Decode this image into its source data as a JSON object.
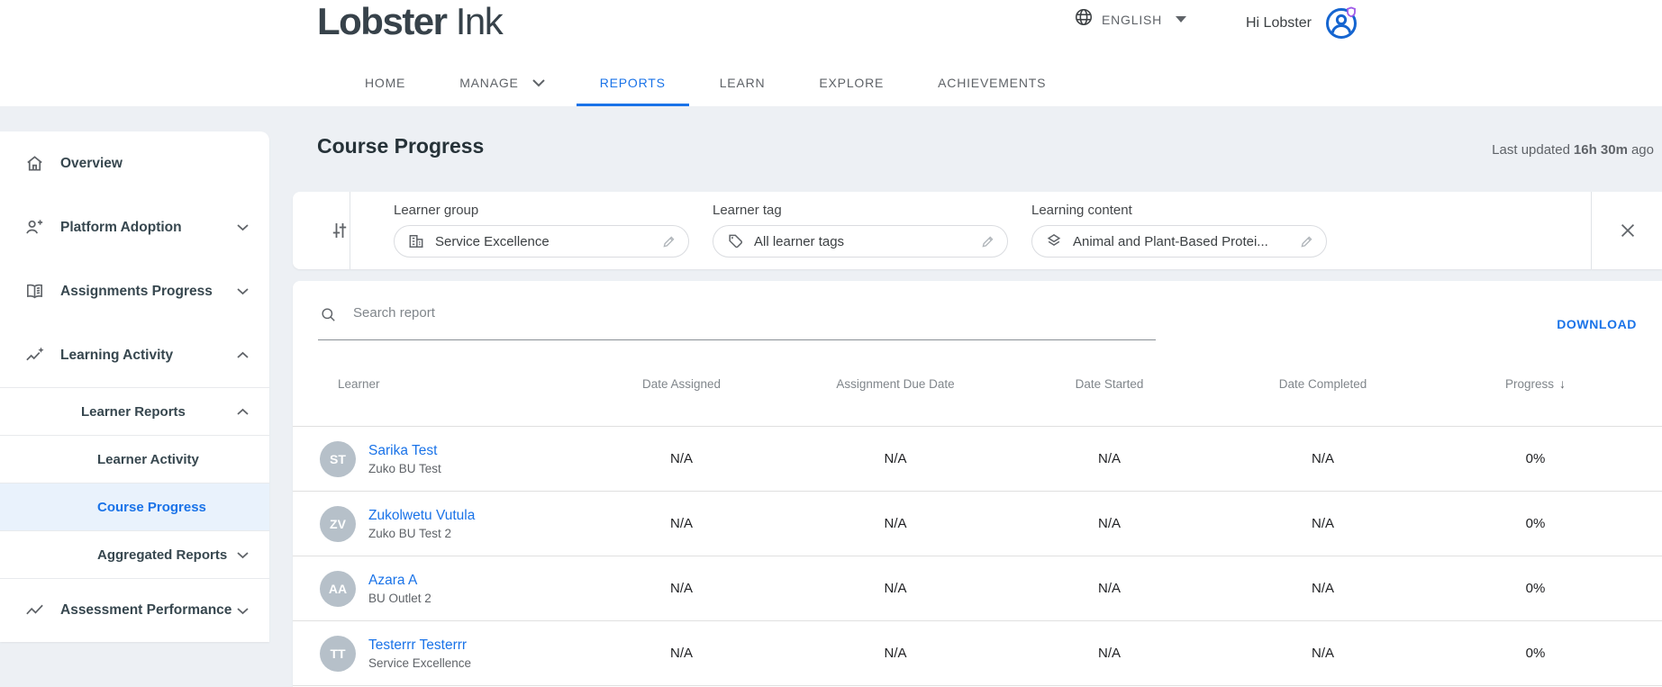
{
  "header": {
    "logo_part1": "Lobster",
    "logo_part2": "Ink",
    "language": "ENGLISH",
    "greeting": "Hi Lobster",
    "nav": {
      "home": "HOME",
      "manage": "MANAGE",
      "reports": "REPORTS",
      "learn": "LEARN",
      "explore": "EXPLORE",
      "achievements": "ACHIEVEMENTS"
    }
  },
  "sidebar": {
    "overview": "Overview",
    "platform_adoption": "Platform Adoption",
    "assignments_progress": "Assignments Progress",
    "learning_activity": "Learning Activity",
    "learner_reports": "Learner Reports",
    "learner_activity": "Learner Activity",
    "course_progress": "Course Progress",
    "aggregated_reports": "Aggregated Reports",
    "assessment_performance": "Assessment Performance"
  },
  "page": {
    "title": "Course Progress",
    "last_updated_label": "Last updated",
    "last_updated_value": "16h 30m",
    "last_updated_suffix": "ago"
  },
  "filters": {
    "learner_group": {
      "label": "Learner group",
      "value": "Service Excellence"
    },
    "learner_tag": {
      "label": "Learner tag",
      "value": "All learner tags"
    },
    "learning_content": {
      "label": "Learning content",
      "value": "Animal and Plant-Based Protei..."
    }
  },
  "report": {
    "search_placeholder": "Search report",
    "download_label": "DOWNLOAD",
    "columns": [
      "Learner",
      "Date Assigned",
      "Assignment Due Date",
      "Date Started",
      "Date Completed",
      "Progress"
    ],
    "sort_icon": "↓",
    "rows": [
      {
        "initials": "ST",
        "name": "Sarika Test",
        "group": "Zuko BU Test",
        "date_assigned": "N/A",
        "due_date": "N/A",
        "date_started": "N/A",
        "date_completed": "N/A",
        "progress": "0%"
      },
      {
        "initials": "ZV",
        "name": "Zukolwetu Vutula",
        "group": "Zuko BU Test 2",
        "date_assigned": "N/A",
        "due_date": "N/A",
        "date_started": "N/A",
        "date_completed": "N/A",
        "progress": "0%"
      },
      {
        "initials": "AA",
        "name": "Azara A",
        "group": "BU Outlet 2",
        "date_assigned": "N/A",
        "due_date": "N/A",
        "date_started": "N/A",
        "date_completed": "N/A",
        "progress": "0%"
      },
      {
        "initials": "TT",
        "name": "Testerrr Testerrr",
        "group": "Service Excellence",
        "date_assigned": "N/A",
        "due_date": "N/A",
        "date_started": "N/A",
        "date_completed": "N/A",
        "progress": "0%"
      }
    ]
  },
  "colors": {
    "accent_blue": "#1a73e8",
    "page_background": "#edf0f4",
    "avatar_gray": "#b6c0c9",
    "badge_purple": "#a05ce8"
  }
}
